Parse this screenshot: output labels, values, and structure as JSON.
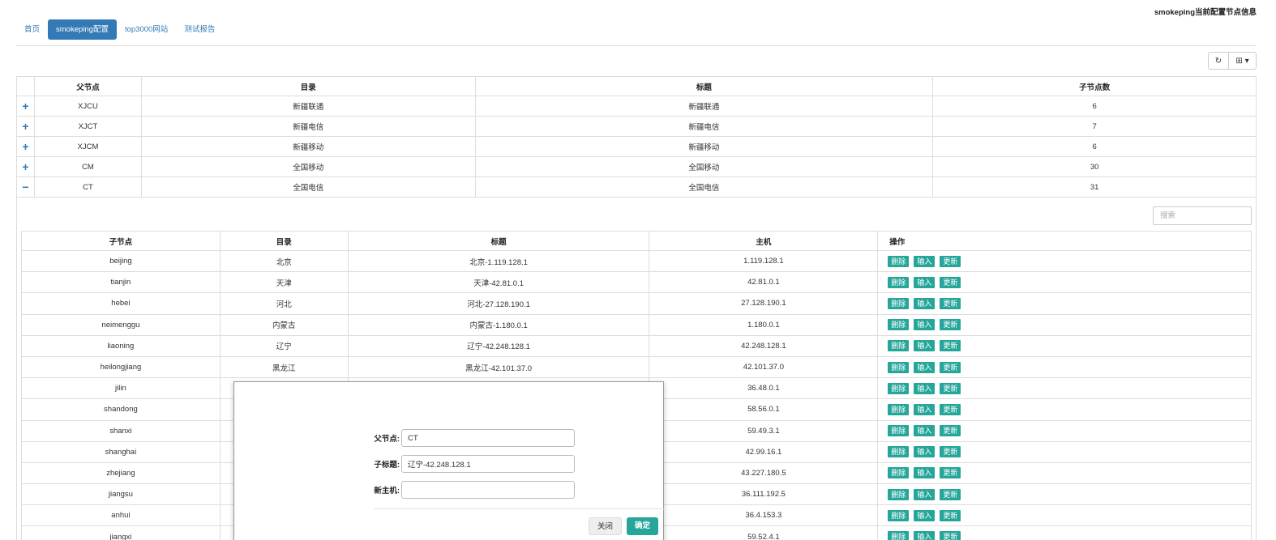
{
  "header": {
    "right_title": "smokeping当前配置节点信息"
  },
  "nav": {
    "tabs": [
      "首页",
      "smokeping配置",
      "top3000网站",
      "测试报告"
    ],
    "active": 1
  },
  "toolbar": {
    "refresh_icon": "↻",
    "columns_icon": "⊞ ▾"
  },
  "outer": {
    "columns": [
      "",
      "父节点",
      "目录",
      "标题",
      "子节点数"
    ],
    "rows": [
      {
        "expander": "+",
        "parent": "XJCU",
        "dir": "新疆联通",
        "title": "新疆联通",
        "count": "6"
      },
      {
        "expander": "+",
        "parent": "XJCT",
        "dir": "新疆电信",
        "title": "新疆电信",
        "count": "7"
      },
      {
        "expander": "+",
        "parent": "XJCM",
        "dir": "新疆移动",
        "title": "新疆移动",
        "count": "6"
      },
      {
        "expander": "+",
        "parent": "CM",
        "dir": "全国移动",
        "title": "全国移动",
        "count": "30"
      },
      {
        "expander": "−",
        "parent": "CT",
        "dir": "全国电信",
        "title": "全国电信",
        "count": "31"
      }
    ]
  },
  "detail": {
    "search_placeholder": "搜索",
    "columns": [
      "子节点",
      "目录",
      "标题",
      "主机",
      "操作"
    ],
    "actions": [
      "删除",
      "输入",
      "更新"
    ],
    "rows": [
      {
        "child": "beijing",
        "dir": "北京",
        "title": "北京-1.119.128.1",
        "host": "1.119.128.1"
      },
      {
        "child": "tianjin",
        "dir": "天津",
        "title": "天津-42.81.0.1",
        "host": "42.81.0.1"
      },
      {
        "child": "hebei",
        "dir": "河北",
        "title": "河北-27.128.190.1",
        "host": "27.128.190.1"
      },
      {
        "child": "neimenggu",
        "dir": "内蒙古",
        "title": "内蒙古-1.180.0.1",
        "host": "1.180.0.1"
      },
      {
        "child": "liaoning",
        "dir": "辽宁",
        "title": "辽宁-42.248.128.1",
        "host": "42.248.128.1"
      },
      {
        "child": "heilongjiang",
        "dir": "黑龙江",
        "title": "黑龙江-42.101.37.0",
        "host": "42.101.37.0"
      },
      {
        "child": "jilin",
        "dir": "",
        "title": "",
        "host": "36.48.0.1"
      },
      {
        "child": "shandong",
        "dir": "",
        "title": "",
        "host": "58.56.0.1"
      },
      {
        "child": "shanxi",
        "dir": "",
        "title": "",
        "host": "59.49.3.1"
      },
      {
        "child": "shanghai",
        "dir": "",
        "title": "",
        "host": "42.99.16.1"
      },
      {
        "child": "zhejiang",
        "dir": "",
        "title": "",
        "host": "43.227.180.5"
      },
      {
        "child": "jiangsu",
        "dir": "",
        "title": "",
        "host": "36.111.192.5"
      },
      {
        "child": "anhui",
        "dir": "",
        "title": "",
        "host": "36.4.153.3"
      },
      {
        "child": "jiangxi",
        "dir": "",
        "title": "",
        "host": "59.52.4.1"
      }
    ]
  },
  "modal": {
    "parent_label": "父节点:",
    "parent_value": "CT",
    "subtitle_label": "子标题:",
    "subtitle_value": "辽宁-42.248.128.1",
    "host_label": "新主机:",
    "host_value": "",
    "close_label": "关闭",
    "ok_label": "确定"
  }
}
